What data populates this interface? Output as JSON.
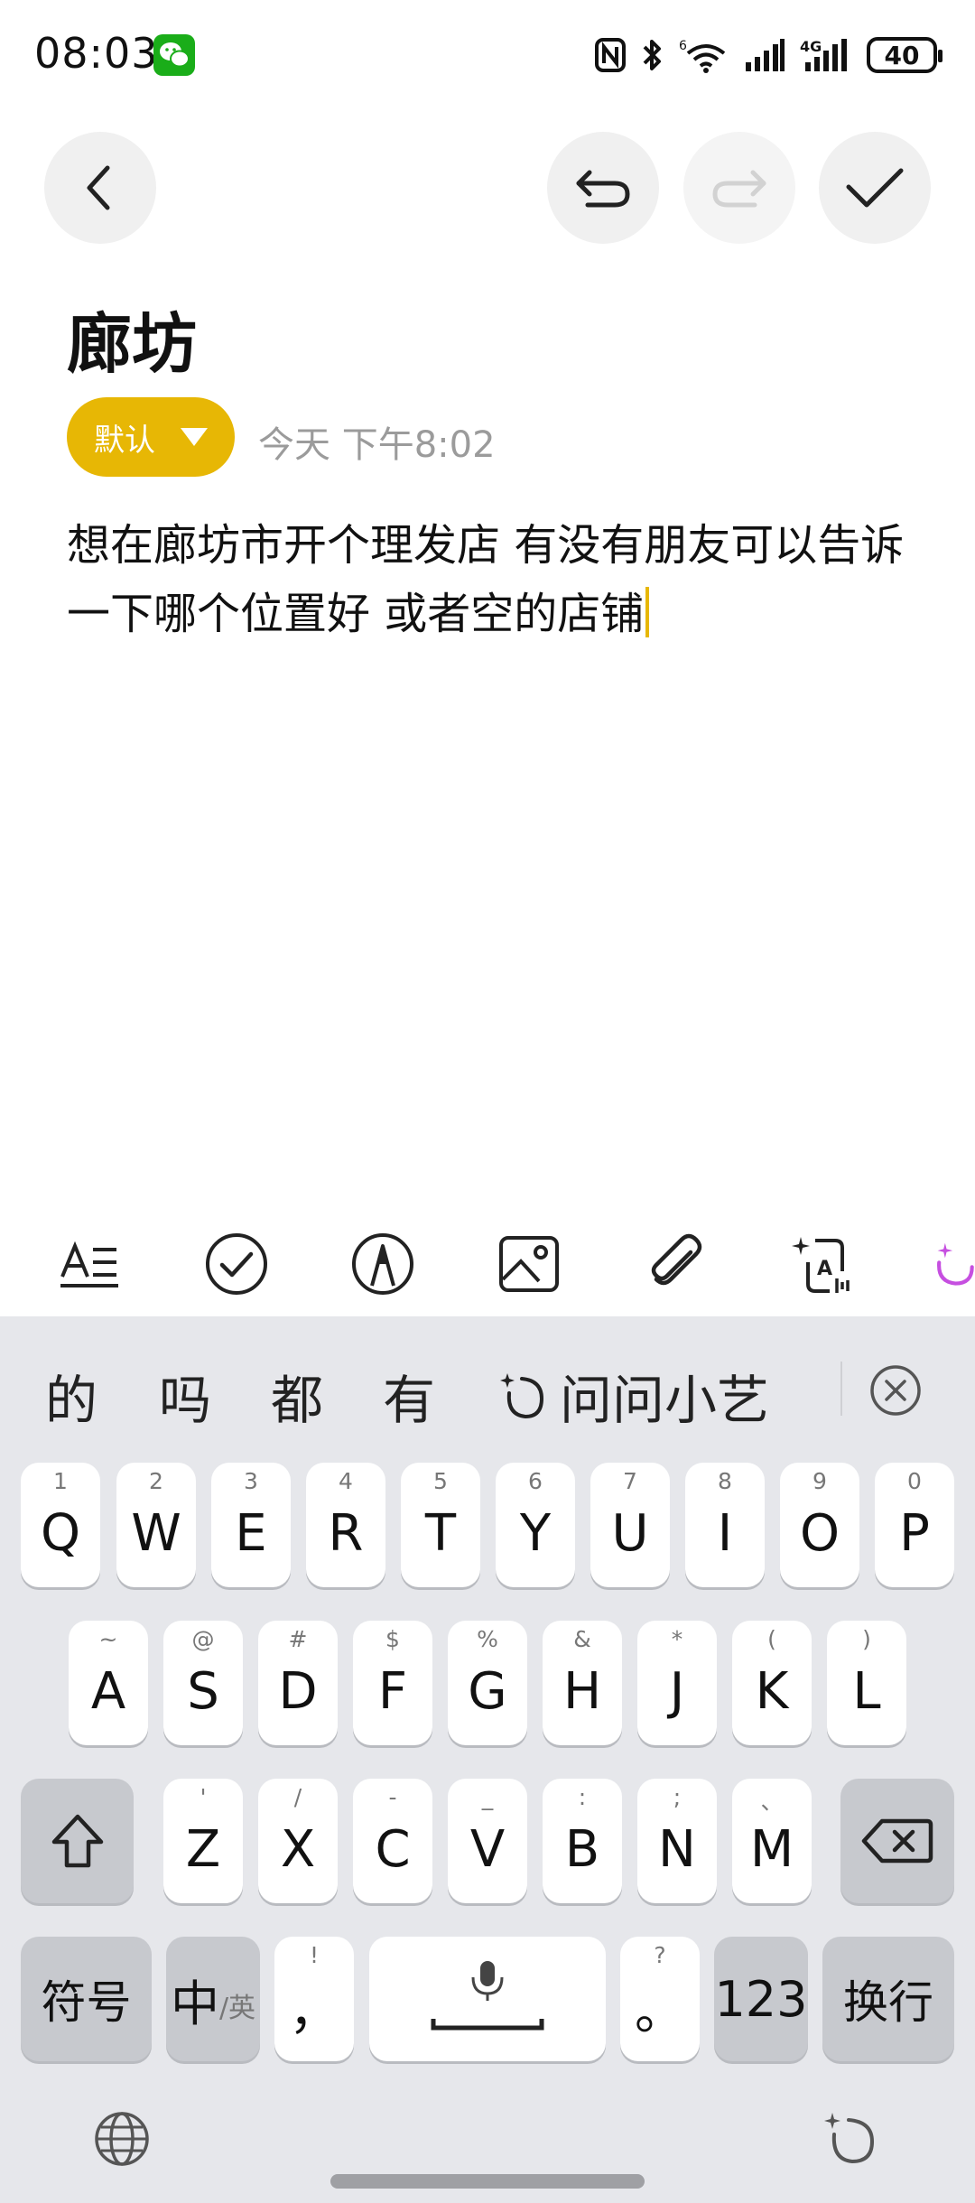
{
  "status_bar": {
    "time": "08:03",
    "battery": "40"
  },
  "note": {
    "title": "廊坊",
    "folder": "默认",
    "date": "今天 下午8:02",
    "body": "想在廊坊市开个理发店 有没有朋友可以告诉一下哪个位置好 或者空的店铺"
  },
  "candidates": [
    "的",
    "吗",
    "都",
    "有"
  ],
  "ai_candidate": "问问小艺",
  "keys": {
    "row1": [
      {
        "hint": "1",
        "label": "Q"
      },
      {
        "hint": "2",
        "label": "W"
      },
      {
        "hint": "3",
        "label": "E"
      },
      {
        "hint": "4",
        "label": "R"
      },
      {
        "hint": "5",
        "label": "T"
      },
      {
        "hint": "6",
        "label": "Y"
      },
      {
        "hint": "7",
        "label": "U"
      },
      {
        "hint": "8",
        "label": "I"
      },
      {
        "hint": "9",
        "label": "O"
      },
      {
        "hint": "0",
        "label": "P"
      }
    ],
    "row2": [
      {
        "hint": "~",
        "label": "A"
      },
      {
        "hint": "@",
        "label": "S"
      },
      {
        "hint": "#",
        "label": "D"
      },
      {
        "hint": "$",
        "label": "F"
      },
      {
        "hint": "%",
        "label": "G"
      },
      {
        "hint": "&",
        "label": "H"
      },
      {
        "hint": "*",
        "label": "J"
      },
      {
        "hint": "(",
        "label": "K"
      },
      {
        "hint": ")",
        "label": "L"
      }
    ],
    "row3": [
      {
        "hint": "'",
        "label": "Z"
      },
      {
        "hint": "/",
        "label": "X"
      },
      {
        "hint": "-",
        "label": "C"
      },
      {
        "hint": "_",
        "label": "V"
      },
      {
        "hint": ":",
        "label": "B"
      },
      {
        "hint": ";",
        "label": "N"
      },
      {
        "hint": "、",
        "label": "M"
      }
    ],
    "symbols": "符号",
    "lang_main": "中",
    "lang_sub": "/英",
    "comma_hint": "!",
    "comma": "，",
    "period_hint": "?",
    "period": "。",
    "numbers": "123",
    "enter": "换行"
  },
  "colors": {
    "accent": "#e7b705",
    "keyboard_bg": "#e6e7eb"
  }
}
